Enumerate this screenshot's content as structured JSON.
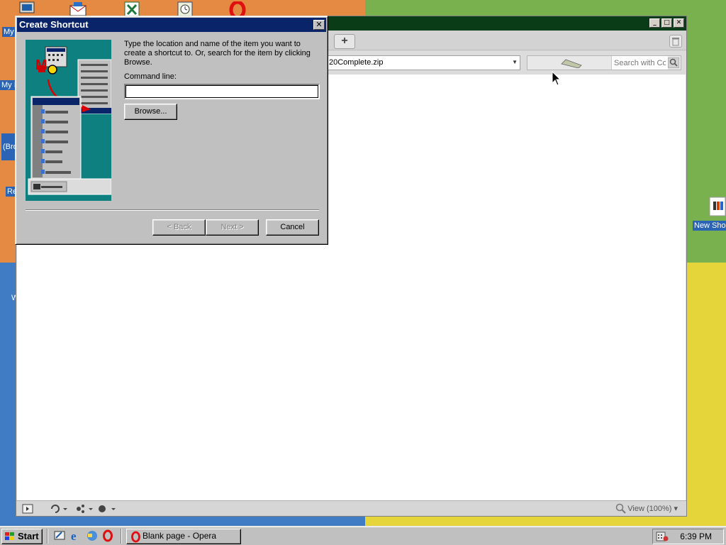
{
  "desktop": {
    "icon_labels": [
      "My",
      "My I",
      "(Bro",
      "Re",
      "W"
    ],
    "new_shortcut_label": "New Shor"
  },
  "browser": {
    "address_value": "20Complete.zip",
    "search_placeholder": "Search with Co",
    "new_tab_icon": "plus-icon",
    "trash_icon": "trash-icon",
    "zoom_label": "View (100%)"
  },
  "dialog": {
    "title": "Create Shortcut",
    "instructions": "Type the location and name of the item you want to create a shortcut to. Or, search for the item by clicking Browse.",
    "command_label": "Command line:",
    "command_value": "",
    "browse_label": "Browse...",
    "back_label": "< Back",
    "next_label": "Next >",
    "cancel_label": "Cancel"
  },
  "taskbar": {
    "start_label": "Start",
    "task_label": "Blank page - Opera",
    "clock": "6:39 PM"
  },
  "colors": {
    "dialog_title": "#0a246a",
    "opera_title": "#0a3c18",
    "face": "#c0c0c0"
  }
}
